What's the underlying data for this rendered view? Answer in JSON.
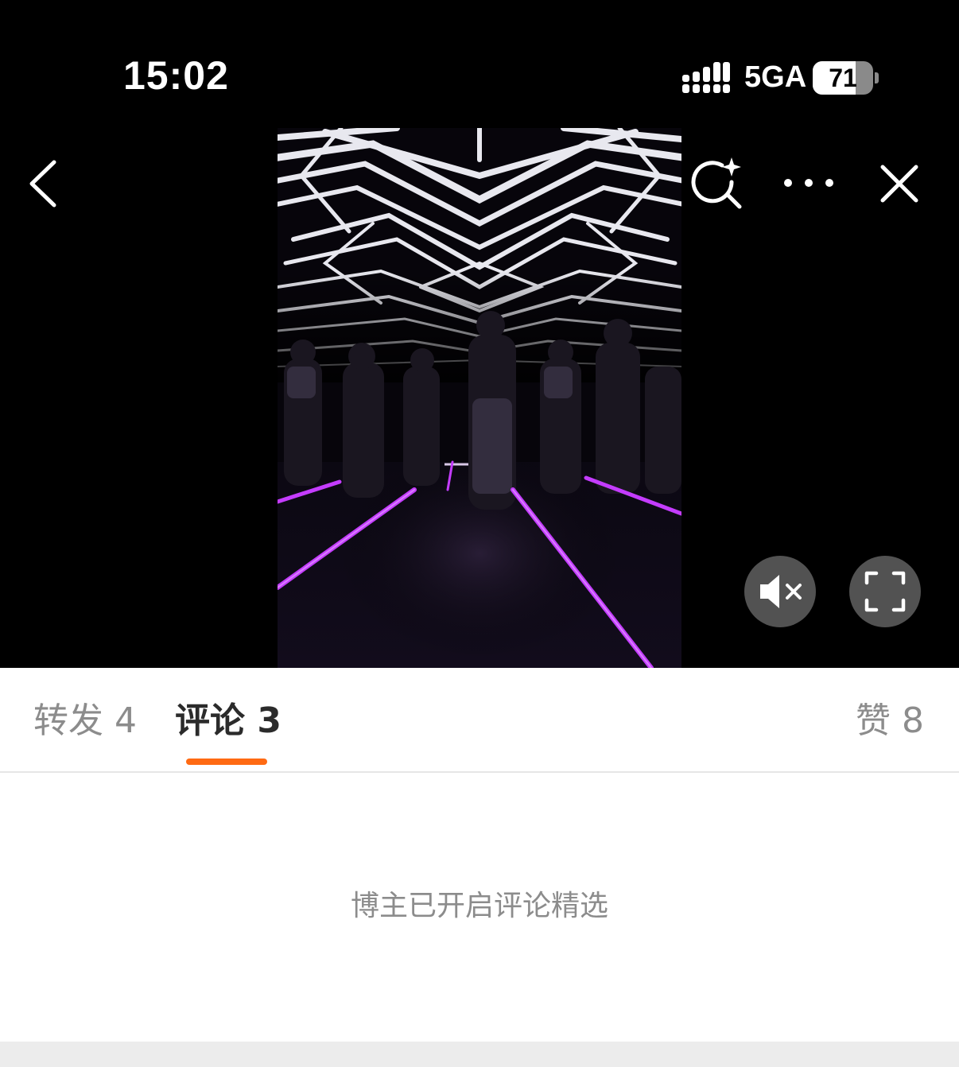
{
  "status_bar": {
    "time": "15:02",
    "network": "5GA",
    "battery_percent": "71",
    "battery_level": 0.71
  },
  "top_bar": {
    "icons": [
      "back-arrow-icon",
      "ai-search-icon",
      "more-icon",
      "close-icon"
    ]
  },
  "video": {
    "controls": [
      "mute-icon",
      "fullscreen-icon"
    ],
    "colors": {
      "background": "#000000",
      "neon": "#c43cff"
    }
  },
  "tabs": {
    "repost": "转发 4",
    "comments": "评论 3",
    "likes": "赞 8",
    "active": "comments",
    "accent_color": "#ff6a13"
  },
  "comments_section": {
    "notice": "博主已开启评论精选"
  }
}
